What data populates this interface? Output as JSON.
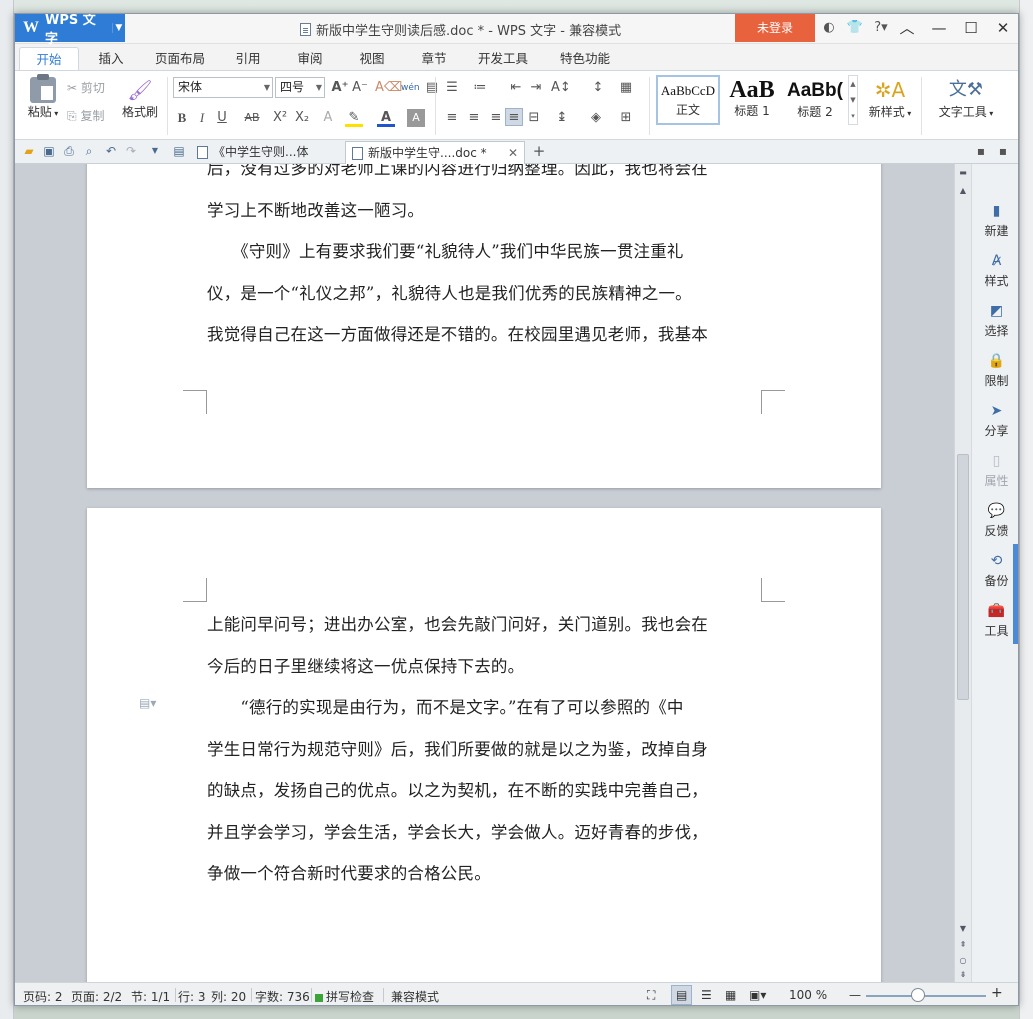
{
  "window": {
    "app_name": "WPS 文字",
    "title": "新版中学生守则读后感.doc * - WPS 文字 - 兼容模式",
    "login_label": "未登录"
  },
  "menu": {
    "tabs": [
      "开始",
      "插入",
      "页面布局",
      "引用",
      "审阅",
      "视图",
      "章节",
      "开发工具",
      "特色功能"
    ]
  },
  "ribbon": {
    "paste": "粘贴",
    "cut": "剪切",
    "copy": "复制",
    "format_painter": "格式刷",
    "font_name": "宋体",
    "font_size": "四号",
    "styles": [
      {
        "sample": "AaBbCcD",
        "label": "正文"
      },
      {
        "sample": "AaB",
        "label": "标题 1"
      },
      {
        "sample": "AaBb(",
        "label": "标题 2"
      }
    ],
    "new_style": "新样式",
    "text_tools": "文字工具",
    "colors": {
      "accent": "#2f7cd6",
      "login": "#e8623d",
      "highlight": "#ffe100",
      "font_color": "#d22"
    }
  },
  "doc_tabs": [
    {
      "label": "《中学生守则...体会.doc"
    },
    {
      "label": "新版中学生守....doc *"
    }
  ],
  "document": {
    "page1_lines": [
      "后，没有过多的对老师上课的内容进行归纳整理。因此，我也将会在",
      "学习上不断地改善这一陋习。",
      "　　《守则》上有要求我们要“礼貌待人”我们中华民族一贯注重礼",
      "仪，是一个“礼仪之邦”，礼貌待人也是我们优秀的民族精神之一。",
      "我觉得自己在这一方面做得还是不错的。在校园里遇见老师，我基本"
    ],
    "page2_lines": [
      "上能问早问号；进出办公室，也会先敲门问好，关门道别。我也会在",
      "今后的日子里继续将这一优点保持下去的。",
      "　　“德行的实现是由行为，而不是文字。”在有了可以参照的《中",
      "学生日常行为规范守则》后，我们所要做的就是以之为鉴，改掉自身",
      "的缺点，发扬自己的优点。以之为契机，在不断的实践中完善自己，",
      "并且学会学习，学会生活，学会长大，学会做人。迈好青春的步伐，",
      "争做一个符合新时代要求的合格公民。"
    ]
  },
  "side_pane": {
    "items": [
      {
        "label": "新建",
        "icon": "new-doc-icon"
      },
      {
        "label": "样式",
        "icon": "style-icon"
      },
      {
        "label": "选择",
        "icon": "select-icon"
      },
      {
        "label": "限制",
        "icon": "restrict-icon"
      },
      {
        "label": "分享",
        "icon": "share-icon"
      },
      {
        "label": "属性",
        "icon": "properties-icon"
      },
      {
        "label": "反馈",
        "icon": "feedback-icon"
      },
      {
        "label": "备份",
        "icon": "backup-icon"
      },
      {
        "label": "工具",
        "icon": "toolbox-icon"
      }
    ]
  },
  "status": {
    "page_code": "页码: 2",
    "pages": "页面: 2/2",
    "section": "节: 1/1",
    "row": "行: 3",
    "col": "列: 20",
    "word_count": "字数: 736",
    "spell_check": "拼写检查",
    "compat_mode": "兼容模式",
    "zoom": "100 %"
  }
}
